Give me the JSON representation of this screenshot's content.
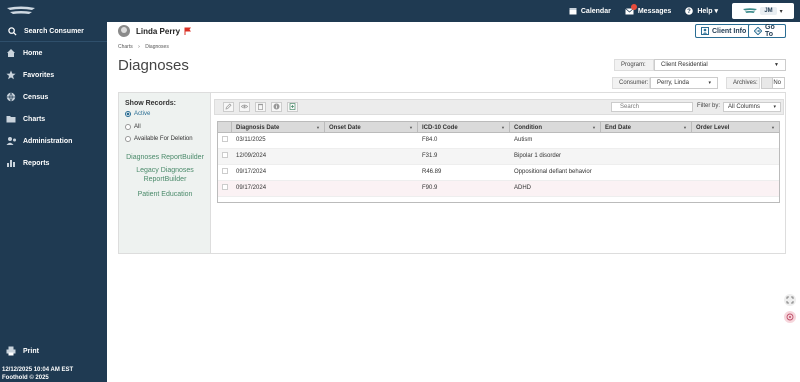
{
  "sidebar": {
    "search_label": "Search Consumer",
    "items": [
      {
        "label": "Home",
        "icon": "home-icon"
      },
      {
        "label": "Favorites",
        "icon": "star-icon"
      },
      {
        "label": "Census",
        "icon": "globe-icon"
      },
      {
        "label": "Charts",
        "icon": "folder-icon"
      },
      {
        "label": "Administration",
        "icon": "admin-icon"
      },
      {
        "label": "Reports",
        "icon": "bar-chart-icon"
      }
    ],
    "print_label": "Print",
    "footer_datetime": "12/12/2025 10:04 AM EST",
    "footer_copyright": "Foothold © 2025"
  },
  "topbar": {
    "calendar_label": "Calendar",
    "messages_label": "Messages",
    "help_label": "Help",
    "help_caret": "▾",
    "user_initials": "JM",
    "user_caret": "▾"
  },
  "client": {
    "name": "Linda Perry",
    "client_info_label": "Client Info",
    "go_to_label": "Go To"
  },
  "breadcrumb": {
    "items": [
      "Charts",
      "Diagnoses"
    ],
    "separator": "›"
  },
  "page": {
    "title": "Diagnoses"
  },
  "filters": {
    "program_label": "Program:",
    "program_value": "Client Residential",
    "consumer_label": "Consumer:",
    "consumer_value": "Perry, Linda",
    "archives_label": "Archives:",
    "archives_value": "No"
  },
  "records": {
    "title": "Show Records:",
    "options": [
      "Active",
      "All",
      "Available For Deletion"
    ],
    "selected": "Active",
    "links": [
      "Diagnoses ReportBuilder",
      "Legacy Diagnoses ReportBuilder",
      "Patient Education"
    ]
  },
  "toolbar": {
    "search_placeholder": "Search",
    "filter_label": "Filter by:",
    "filter_value": "All Columns"
  },
  "grid": {
    "columns": [
      "Diagnosis Date",
      "Onset Date",
      "ICD-10 Code",
      "Condition",
      "End Date",
      "Order Level"
    ],
    "rows": [
      [
        "03/11/2025",
        "",
        "F84.0",
        "Autism",
        "",
        ""
      ],
      [
        "12/09/2024",
        "",
        "F31.9",
        "Bipolar 1 disorder",
        "",
        ""
      ],
      [
        "09/17/2024",
        "",
        "R46.89",
        "Oppositional defiant behavior",
        "",
        ""
      ],
      [
        "09/17/2024",
        "",
        "F90.9",
        "ADHD",
        "",
        ""
      ]
    ]
  },
  "colors": {
    "sidebar_bg": "#1f3a52",
    "accent": "#2a6d93",
    "link_green": "#4a8a6a",
    "flag_red": "#d93025"
  }
}
